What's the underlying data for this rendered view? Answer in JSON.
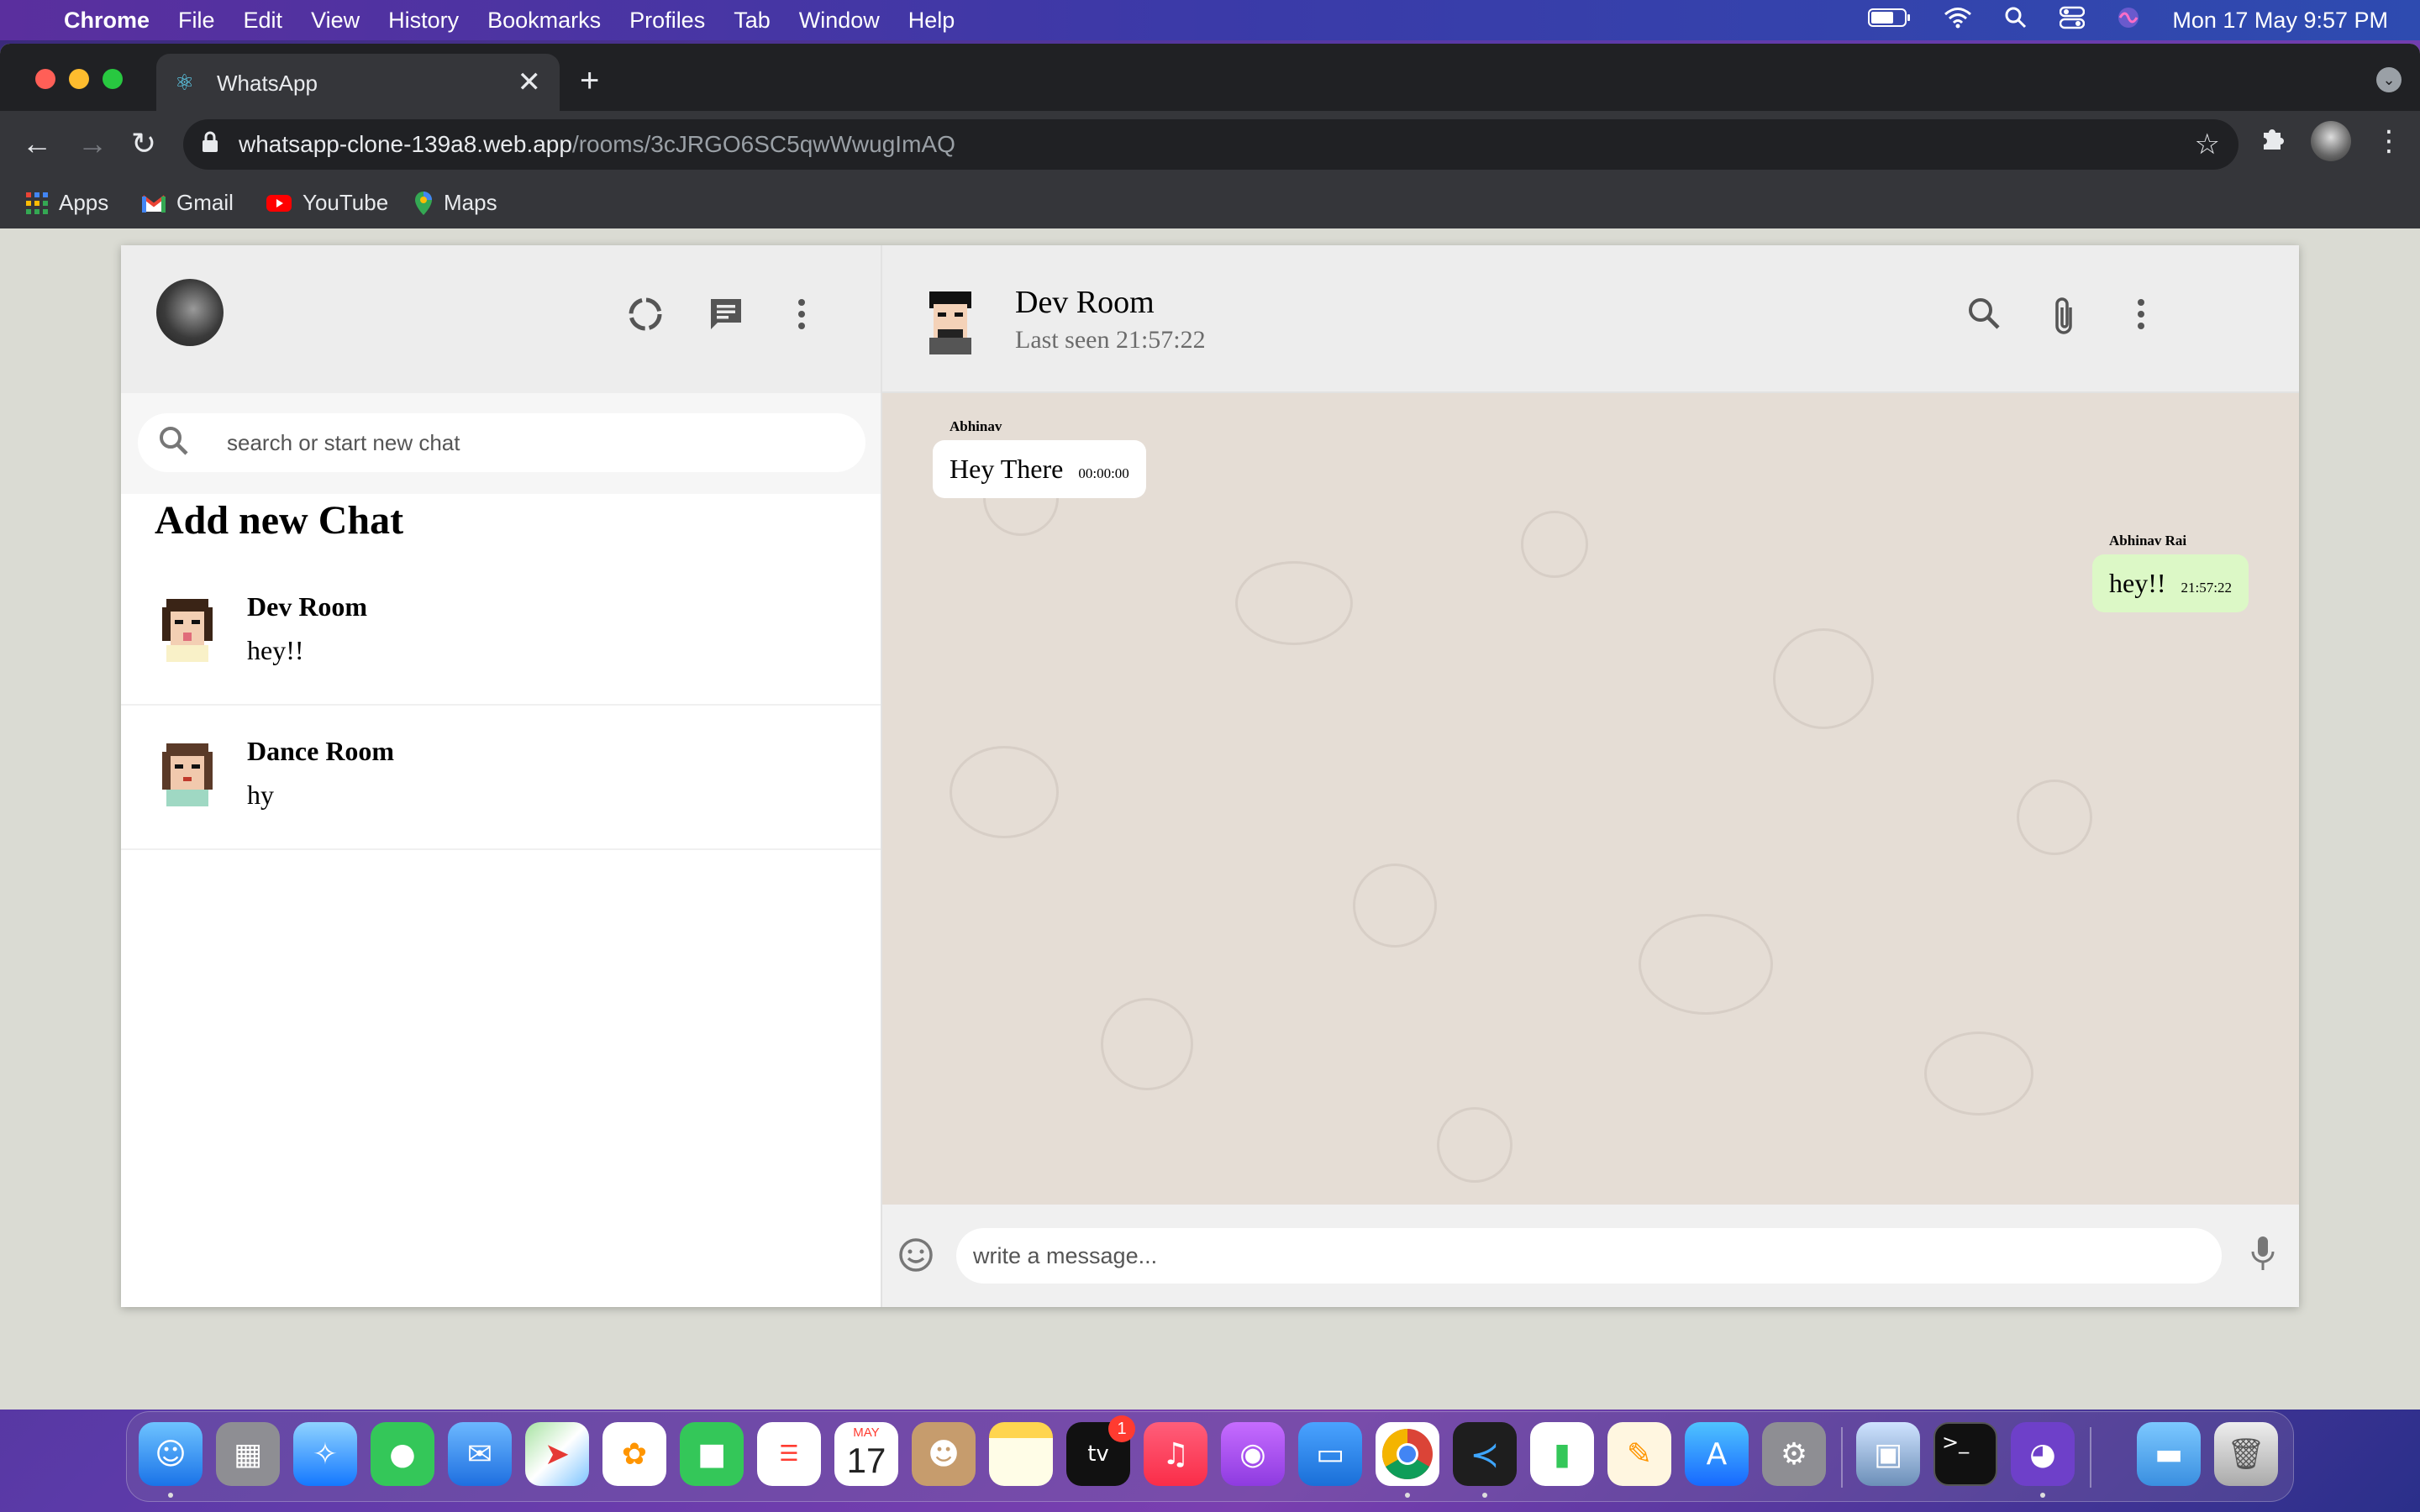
{
  "menubar": {
    "apple": "",
    "app_name": "Chrome",
    "items": [
      "File",
      "Edit",
      "View",
      "History",
      "Bookmarks",
      "Profiles",
      "Tab",
      "Window",
      "Help"
    ],
    "datetime": "Mon 17 May  9:57 PM"
  },
  "browser": {
    "tab_title": "WhatsApp",
    "tab_close": "✕",
    "new_tab": "+",
    "url_host": "whatsapp-clone-139a8.web.app",
    "url_path": "/rooms/3cJRGO6SC5qwWwugImAQ",
    "bookmarks": [
      "Apps",
      "Gmail",
      "YouTube",
      "Maps"
    ]
  },
  "sidebar": {
    "search_placeholder": "search or start new chat",
    "add_new_chat": "Add new Chat",
    "chats": [
      {
        "name": "Dev Room",
        "last_message": "hey!!"
      },
      {
        "name": "Dance Room",
        "last_message": "hy"
      }
    ]
  },
  "chat": {
    "room_name": "Dev Room",
    "last_seen": "Last seen 21:57:22",
    "messages": [
      {
        "sender": "Abhinav",
        "text": "Hey There",
        "time": "00:00:00",
        "sent": false
      },
      {
        "sender": "Abhinav Rai",
        "text": "hey!!",
        "time": "21:57:22",
        "sent": true
      }
    ],
    "composer_placeholder": "write a message..."
  },
  "dock": {
    "apps": [
      "Finder",
      "Launchpad",
      "Safari",
      "Messages",
      "Mail",
      "Maps",
      "Photos",
      "FaceTime",
      "Reminders",
      "Calendar",
      "Contacts",
      "Notes",
      "TV",
      "Music",
      "Podcasts",
      "Keynote",
      "Chrome",
      "VS Code",
      "Numbers",
      "Pages",
      "App Store",
      "System Preferences",
      "Preview",
      "Terminal",
      "GitHub Desktop",
      "Downloads",
      "Trash"
    ],
    "calendar_month": "MAY",
    "calendar_day": "17",
    "tv_badge": "1"
  },
  "colors": {
    "chat_bg": "#e5ddd5",
    "sent_bubble": "#dcf8c6",
    "received_bubble": "#ffffff",
    "header_bg": "#ededed"
  }
}
